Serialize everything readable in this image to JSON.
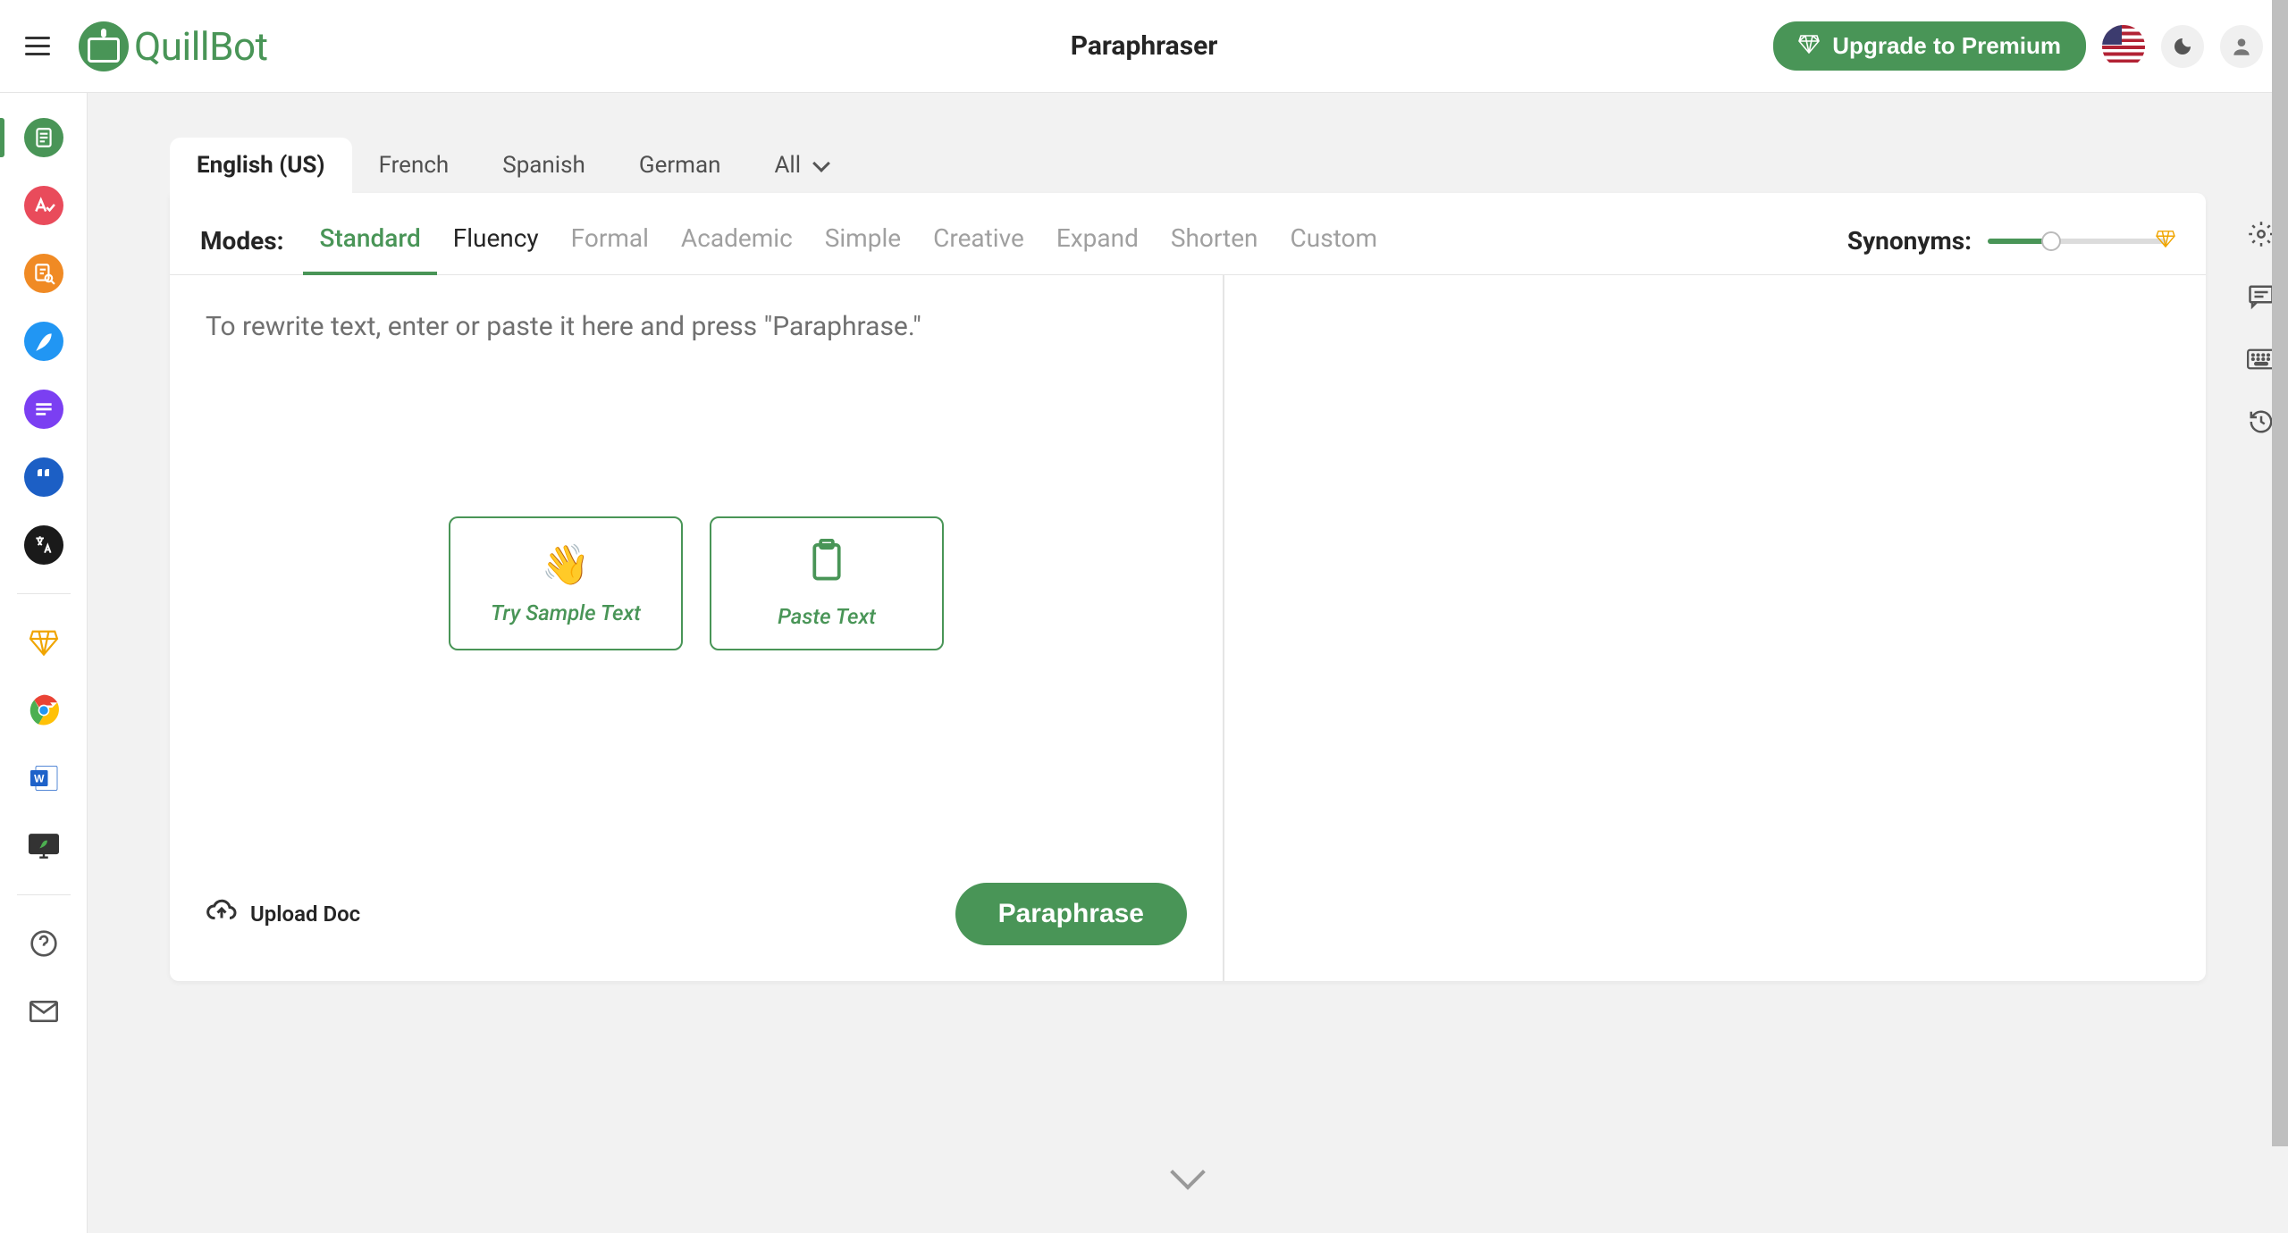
{
  "header": {
    "page_title": "Paraphraser",
    "logo_text": "QuillBot",
    "upgrade_label": "Upgrade to Premium"
  },
  "left_sidebar": {
    "items": [
      {
        "name": "paraphraser",
        "bg": "#499557",
        "glyph": "📄",
        "active": true
      },
      {
        "name": "grammar-checker",
        "bg": "#e94b5b",
        "glyph": "A✓"
      },
      {
        "name": "plagiarism-checker",
        "bg": "#f08a24",
        "glyph": "🔍"
      },
      {
        "name": "co-writer",
        "bg": "#2196f3",
        "glyph": "✒"
      },
      {
        "name": "summarizer",
        "bg": "#7b3ff2",
        "glyph": "☰"
      },
      {
        "name": "citation-generator",
        "bg": "#1c5fc5",
        "glyph": "❝"
      },
      {
        "name": "translator",
        "bg": "#1a1a1a",
        "glyph": "文"
      }
    ]
  },
  "lang_tabs": {
    "items": [
      {
        "label": "English (US)",
        "active": true
      },
      {
        "label": "French"
      },
      {
        "label": "Spanish"
      },
      {
        "label": "German"
      },
      {
        "label": "All",
        "dropdown": true
      }
    ]
  },
  "modes": {
    "label": "Modes:",
    "items": [
      {
        "label": "Standard",
        "active": true
      },
      {
        "label": "Fluency"
      },
      {
        "label": "Formal",
        "disabled": true
      },
      {
        "label": "Academic",
        "disabled": true
      },
      {
        "label": "Simple",
        "disabled": true
      },
      {
        "label": "Creative",
        "disabled": true
      },
      {
        "label": "Expand",
        "disabled": true
      },
      {
        "label": "Shorten",
        "disabled": true
      },
      {
        "label": "Custom",
        "disabled": true
      }
    ],
    "synonyms_label": "Synonyms:"
  },
  "editor": {
    "placeholder": "To rewrite text, enter or paste it here and press \"Paraphrase.\"",
    "sample_btn": "Try Sample Text",
    "paste_btn": "Paste Text",
    "upload_label": "Upload Doc",
    "paraphrase_btn": "Paraphrase"
  }
}
